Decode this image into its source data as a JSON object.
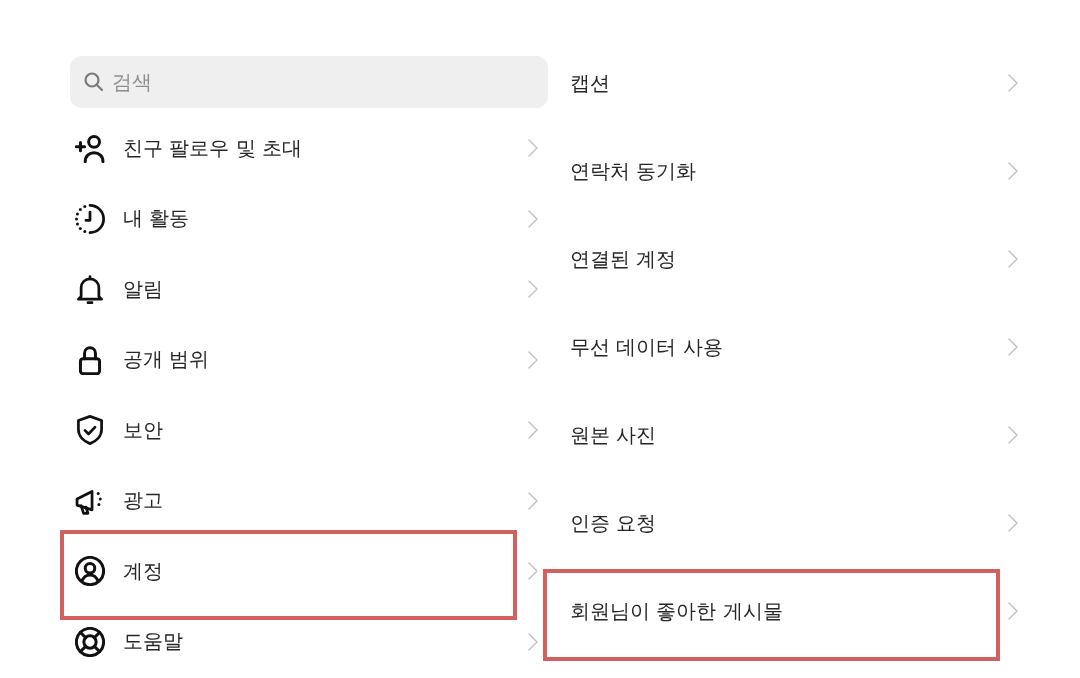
{
  "search": {
    "placeholder": "검색"
  },
  "left_items": [
    {
      "label": "친구 팔로우 및 초대",
      "highlighted": false
    },
    {
      "label": "내 활동",
      "highlighted": false
    },
    {
      "label": "알림",
      "highlighted": false
    },
    {
      "label": "공개 범위",
      "highlighted": false
    },
    {
      "label": "보안",
      "highlighted": false
    },
    {
      "label": "광고",
      "highlighted": false
    },
    {
      "label": "계정",
      "highlighted": true
    },
    {
      "label": "도움말",
      "highlighted": false
    }
  ],
  "right_items": [
    {
      "label": "캡션",
      "highlighted": false
    },
    {
      "label": "연락처 동기화",
      "highlighted": false
    },
    {
      "label": "연결된 계정",
      "highlighted": false
    },
    {
      "label": "무선 데이터 사용",
      "highlighted": false
    },
    {
      "label": "원본 사진",
      "highlighted": false
    },
    {
      "label": "인증 요청",
      "highlighted": false
    },
    {
      "label": "회원님이 좋아한 게시물",
      "highlighted": true
    }
  ]
}
